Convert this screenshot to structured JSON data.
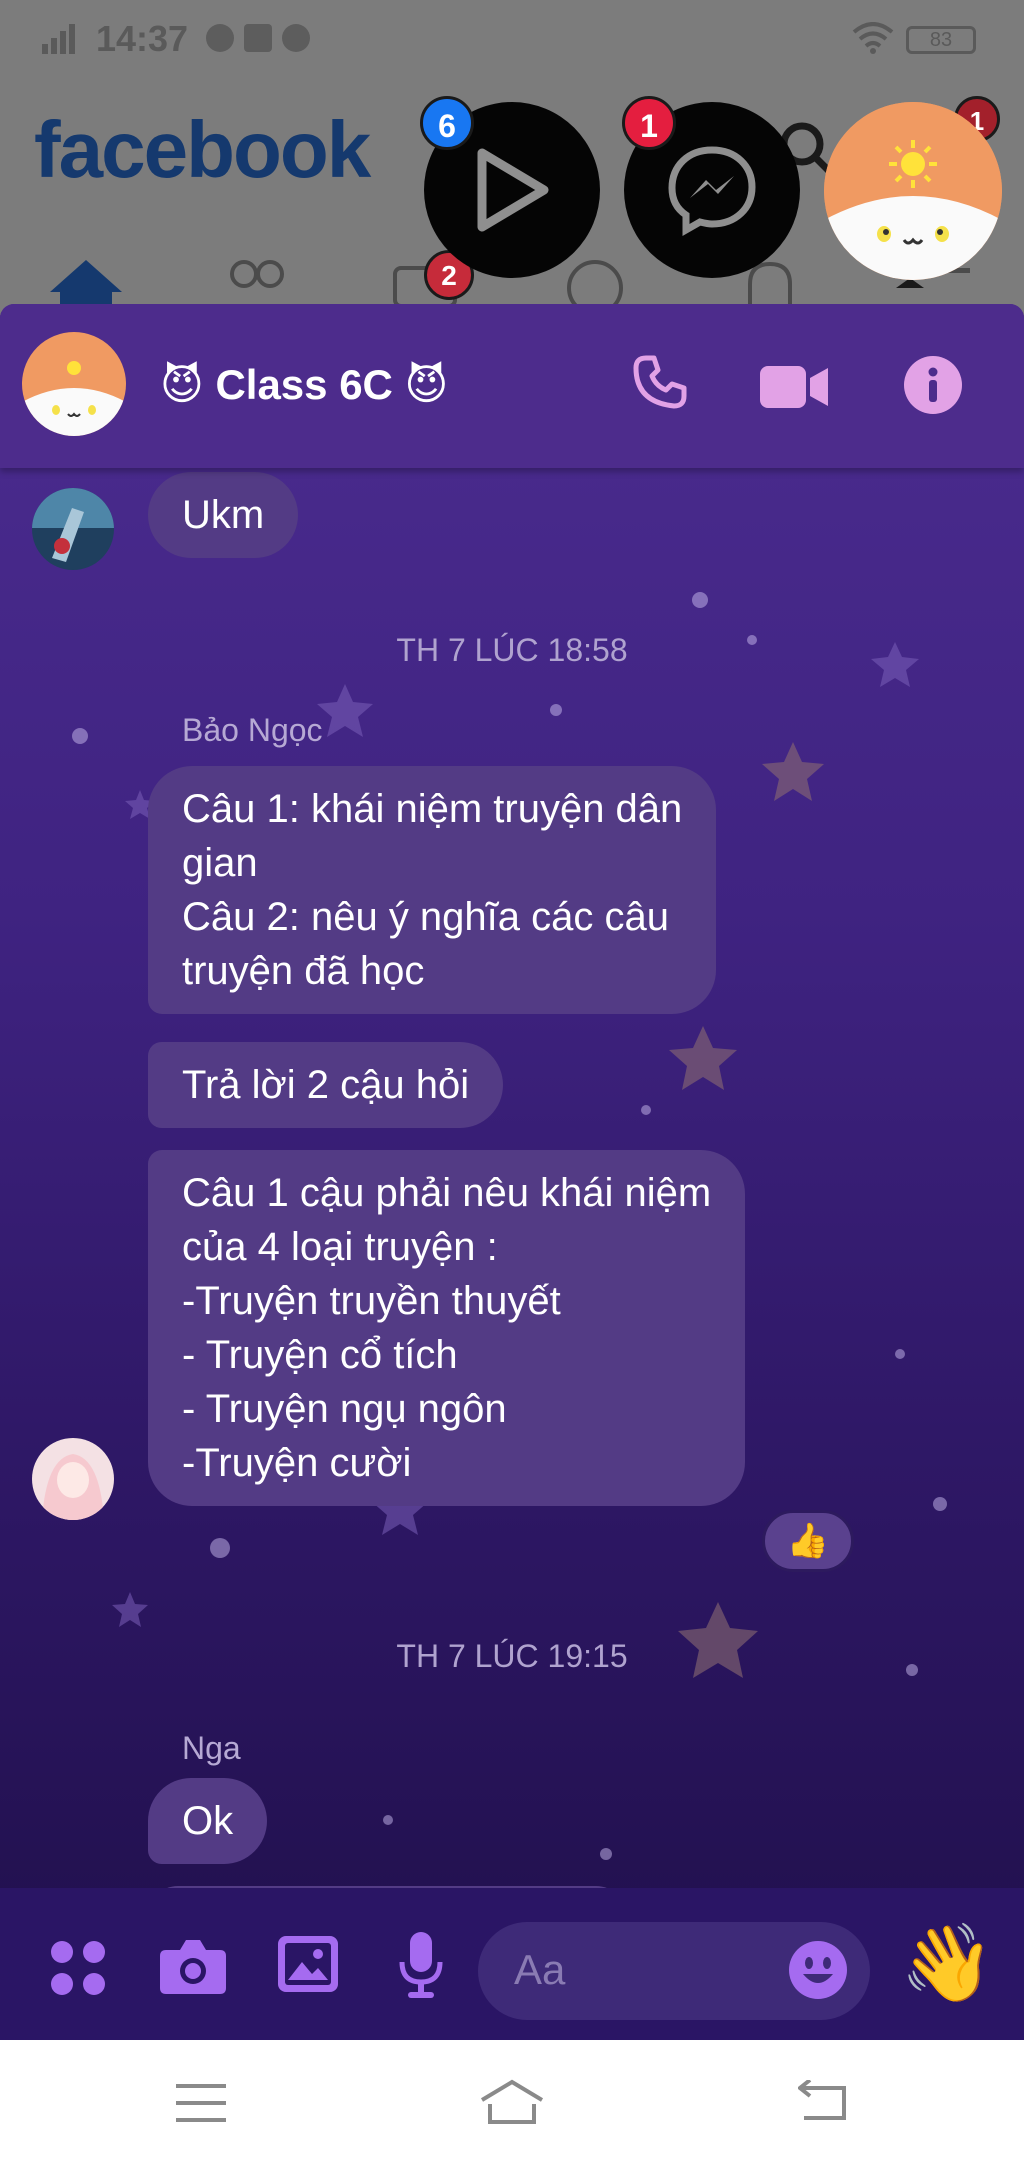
{
  "status_bar": {
    "time": "14:37",
    "battery": "83"
  },
  "facebook": {
    "logo": "facebook",
    "tab_badge": "2"
  },
  "chat_heads": [
    {
      "name": "video-chathead",
      "badge": "6",
      "badge_color": "#1877f2"
    },
    {
      "name": "messenger-chathead",
      "badge": "1",
      "badge_color": "#e41e3f"
    },
    {
      "name": "group-chathead",
      "badge": "1",
      "badge_color": "#e41e3f"
    }
  ],
  "header": {
    "title": "😈 Class 6C 😈",
    "icons": [
      "phone-icon",
      "video-camera-icon",
      "info-icon"
    ]
  },
  "messages": {
    "ukm": "Ukm",
    "timestamp_1": "TH 7 LÚC 18:58",
    "sender_1": "Bảo Ngọc",
    "msg_1": [
      "Câu 1: khái niệm truyện dân",
      "gian",
      "Câu 2: nêu ý nghĩa các câu",
      "truyện đã học"
    ],
    "msg_2": "Trả lời 2 cậu hỏi",
    "msg_3": [
      "Câu 1 cậu phải nêu khái niệm",
      "của 4 loại truyện :",
      "-Truyện truyền thuyết",
      "- Truyện cổ tích",
      "- Truyện ngụ ngôn",
      "-Truyện cười"
    ],
    "reaction": "👍",
    "timestamp_2": "TH 7 LÚC 19:15",
    "sender_2": "Nga",
    "msg_4": "Ok"
  },
  "composer": {
    "placeholder": "Aa",
    "icons": [
      "apps-icon",
      "camera-icon",
      "gallery-icon",
      "microphone-icon",
      "emoji-icon",
      "wave-hand-icon"
    ],
    "wave": "👋"
  },
  "colors": {
    "panel_header": "#4d2c8c",
    "bubble": "#533b85",
    "icon_pink": "#e2a2e6",
    "icon_purple": "#a56bf0"
  }
}
